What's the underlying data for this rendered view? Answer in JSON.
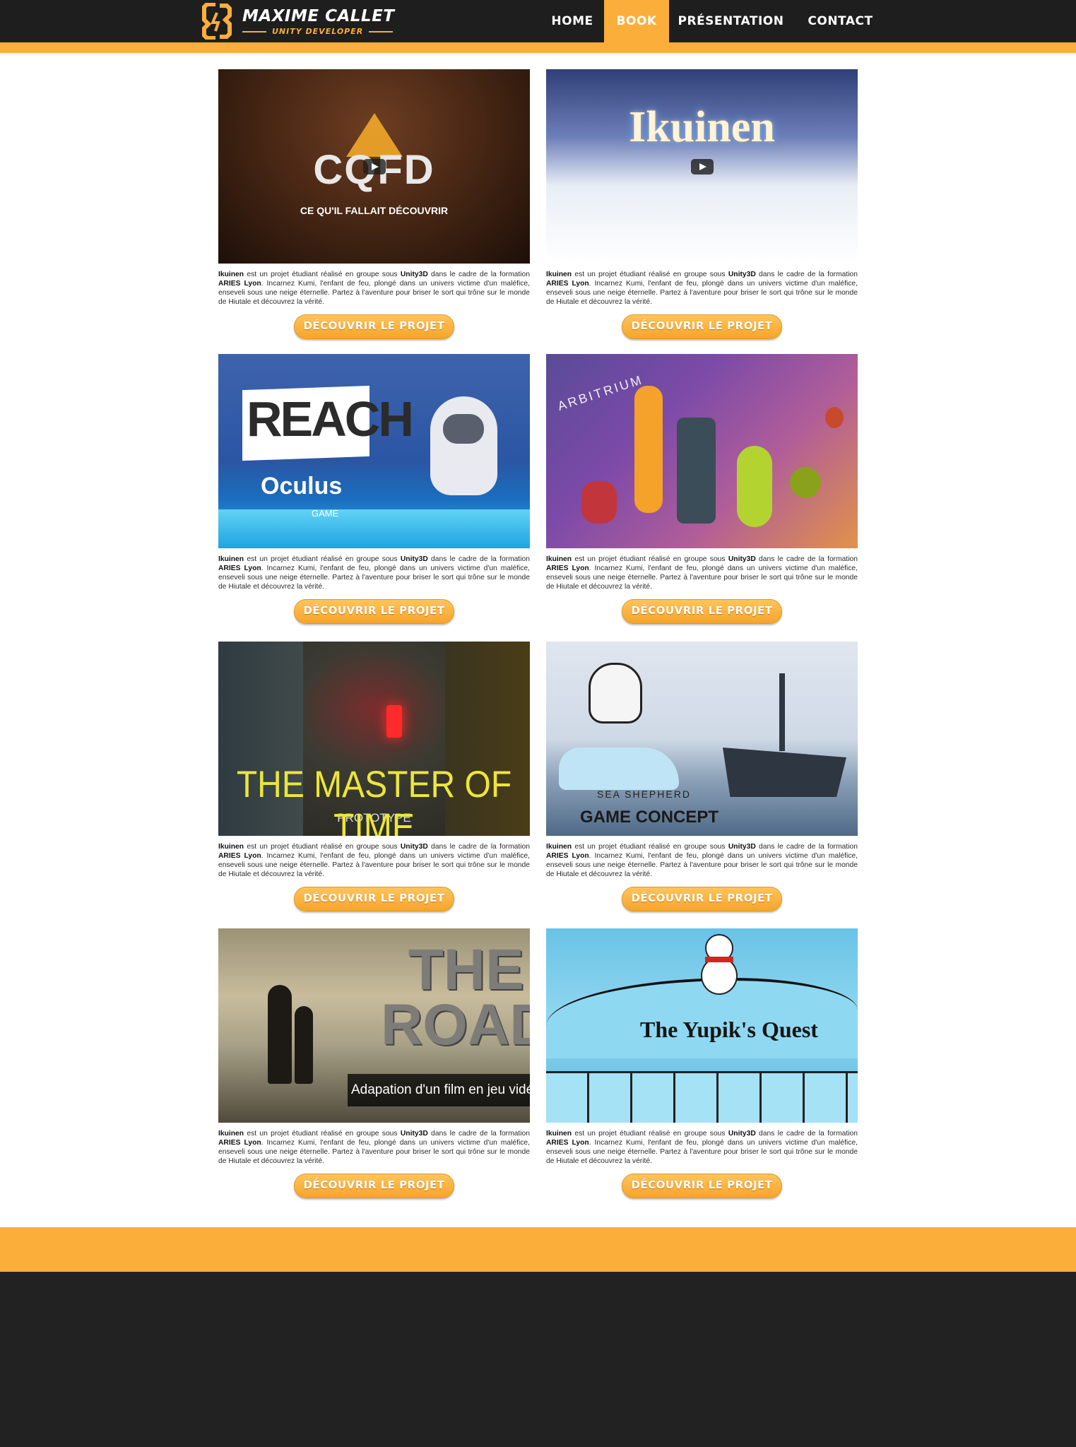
{
  "header": {
    "logo_name": "MAXIME CALLET",
    "logo_subtitle": "UNITY DEVELOPER",
    "nav": [
      {
        "label": "HOME",
        "active": false
      },
      {
        "label": "BOOK",
        "active": true
      },
      {
        "label": "PRÉSENTATION",
        "active": false
      },
      {
        "label": "CONTACT",
        "active": false
      }
    ]
  },
  "colors": {
    "accent": "#fbae3a",
    "dark": "#1e1e1f",
    "background": "#ffffff"
  },
  "projects": [
    {
      "image_title": "CQFD",
      "image_subtitle": "CE QU'IL FALLAIT DÉCOUVRIR",
      "has_play_icon": true,
      "desc": {
        "name": "Ikuinen",
        "t1": " est un projet étudiant réalisé en groupe sous ",
        "engine": "Unity3D",
        "t2": " dans le cadre de la formation ",
        "school": "ARIES Lyon",
        "t3": ". Incarnez Kumi, l'enfant de feu, plongé dans un univers victime d'un maléfice, enseveli sous une neige éternelle. Partez à l'aventure pour briser le sort qui trône sur le monde de Hiutale et découvrez la vérité."
      },
      "button": "DÉCOUVRIR LE PROJET"
    },
    {
      "image_title": "Ikuinen",
      "image_subtitle": "",
      "has_play_icon": true,
      "desc": {
        "name": "Ikuinen",
        "t1": " est un projet étudiant réalisé en groupe sous ",
        "engine": "Unity3D",
        "t2": " dans le cadre de la formation ",
        "school": "ARIES Lyon",
        "t3": ". Incarnez Kumi, l'enfant de feu, plongé dans un univers victime d'un maléfice, enseveli sous une neige éternelle. Partez à l'aventure pour briser le sort qui trône sur le monde de Hiutale et découvrez la vérité."
      },
      "button": "DÉCOUVRIR LE PROJET"
    },
    {
      "image_title": "REACH",
      "image_subtitle": "Oculus",
      "image_subtitle2": "GAME",
      "has_play_icon": false,
      "desc": {
        "name": "Ikuinen",
        "t1": " est un projet étudiant réalisé en groupe sous ",
        "engine": "Unity3D",
        "t2": " dans le cadre de la formation ",
        "school": "ARIES Lyon",
        "t3": ". Incarnez Kumi, l'enfant de feu, plongé dans un univers victime d'un maléfice, enseveli sous une neige éternelle. Partez à l'aventure pour briser le sort qui trône sur le monde de Hiutale et découvrez la vérité."
      },
      "button": "DÉCOUVRIR LE PROJET"
    },
    {
      "image_title": "ARBITRIUM",
      "image_subtitle": "",
      "has_play_icon": false,
      "desc": {
        "name": "Ikuinen",
        "t1": " est un projet étudiant réalisé en groupe sous ",
        "engine": "Unity3D",
        "t2": " dans le cadre de la formation ",
        "school": "ARIES Lyon",
        "t3": ". Incarnez Kumi, l'enfant de feu, plongé dans un univers victime d'un maléfice, enseveli sous une neige éternelle. Partez à l'aventure pour briser le sort qui trône sur le monde de Hiutale et découvrez la vérité."
      },
      "button": "DÉCOUVRIR LE PROJET"
    },
    {
      "image_title": "THE MASTER OF TIME",
      "image_subtitle": "PROTOTYPE",
      "has_play_icon": false,
      "desc": {
        "name": "Ikuinen",
        "t1": " est un projet étudiant réalisé en groupe sous ",
        "engine": "Unity3D",
        "t2": " dans le cadre de la formation ",
        "school": "ARIES Lyon",
        "t3": ". Incarnez Kumi, l'enfant de feu, plongé dans un univers victime d'un maléfice, enseveli sous une neige éternelle. Partez à l'aventure pour briser le sort qui trône sur le monde de Hiutale et découvrez la vérité."
      },
      "button": "DÉCOUVRIR LE PROJET"
    },
    {
      "image_title": "GAME CONCEPT",
      "image_subtitle": "SEA SHEPHERD",
      "has_play_icon": false,
      "desc": {
        "name": "Ikuinen",
        "t1": " est un projet étudiant réalisé en groupe sous ",
        "engine": "Unity3D",
        "t2": " dans le cadre de la formation ",
        "school": "ARIES Lyon",
        "t3": ". Incarnez Kumi, l'enfant de feu, plongé dans un univers victime d'un maléfice, enseveli sous une neige éternelle. Partez à l'aventure pour briser le sort qui trône sur le monde de Hiutale et découvrez la vérité."
      },
      "button": "DÉCOUVRIR LE PROJET"
    },
    {
      "image_title": "THE ROAD",
      "image_subtitle": "Adapation d'un film en jeu vidéo",
      "has_play_icon": false,
      "desc": {
        "name": "Ikuinen",
        "t1": " est un projet étudiant réalisé en groupe sous ",
        "engine": "Unity3D",
        "t2": " dans le cadre de la formation ",
        "school": "ARIES Lyon",
        "t3": ". Incarnez Kumi, l'enfant de feu, plongé dans un univers victime d'un maléfice, enseveli sous une neige éternelle. Partez à l'aventure pour briser le sort qui trône sur le monde de Hiutale et découvrez la vérité."
      },
      "button": "DÉCOUVRIR LE PROJET"
    },
    {
      "image_title": "The Yupik's Quest",
      "image_subtitle": "",
      "has_play_icon": false,
      "desc": {
        "name": "Ikuinen",
        "t1": " est un projet étudiant réalisé en groupe sous ",
        "engine": "Unity3D",
        "t2": " dans le cadre de la formation ",
        "school": "ARIES Lyon",
        "t3": ". Incarnez Kumi, l'enfant de feu, plongé dans un univers victime d'un maléfice, enseveli sous une neige éternelle. Partez à l'aventure pour briser le sort qui trône sur le monde de Hiutale et découvrez la vérité."
      },
      "button": "DÉCOUVRIR LE PROJET"
    }
  ]
}
